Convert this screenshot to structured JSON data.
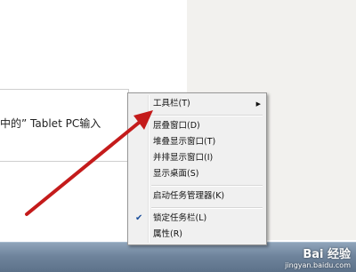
{
  "document": {
    "text": "中的” Tablet PC输入"
  },
  "context_menu": {
    "items": [
      {
        "label": "工具栏(T)",
        "submenu": true
      },
      {
        "label": "层叠窗口(D)"
      },
      {
        "label": "堆叠显示窗口(T)"
      },
      {
        "label": "并排显示窗口(I)"
      },
      {
        "label": "显示桌面(S)"
      },
      {
        "label": "启动任务管理器(K)"
      },
      {
        "label": "锁定任务栏(L)",
        "checked": true
      },
      {
        "label": "属性(R)"
      }
    ],
    "submenu_glyph": "▶",
    "check_glyph": "✔"
  },
  "annotation": {
    "arrow_color": "#c41b1b"
  },
  "watermark": {
    "brand": "Bai 经验",
    "url": "jingyan.baidu.com"
  }
}
